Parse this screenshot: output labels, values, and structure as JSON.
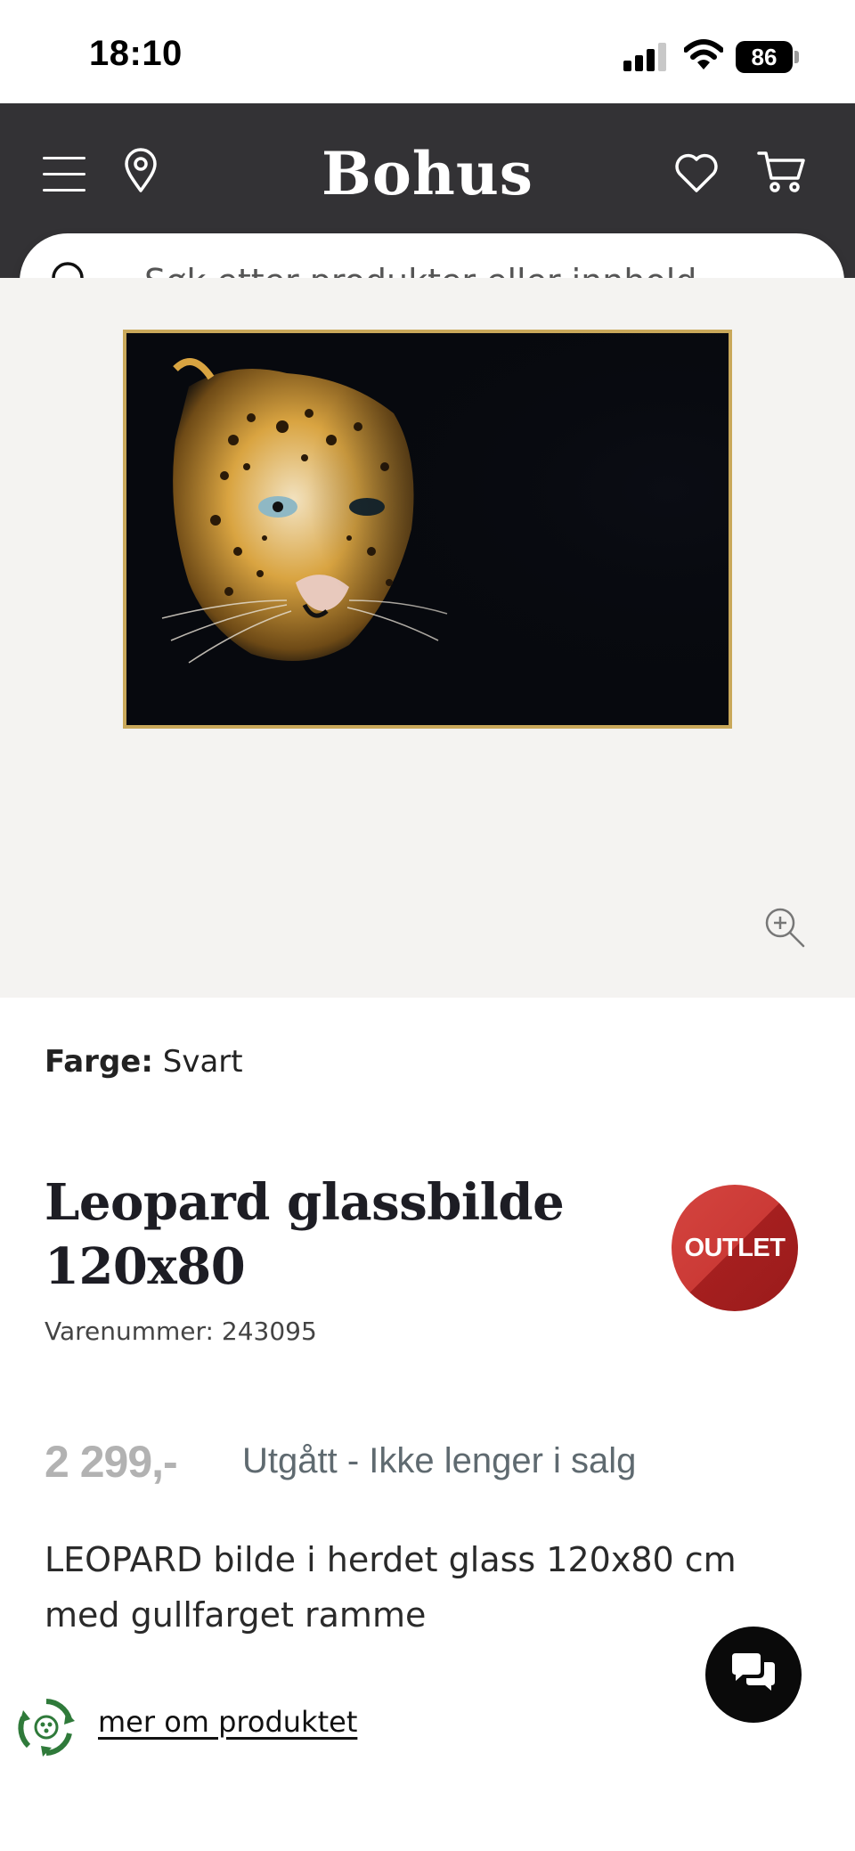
{
  "status_bar": {
    "time": "18:10",
    "battery": "86",
    "icons": [
      "signal-icon",
      "wifi-icon",
      "battery-icon"
    ]
  },
  "header": {
    "logo": "Bohus",
    "icons": [
      "menu-icon",
      "location-pin-icon",
      "heart-icon",
      "cart-icon"
    ],
    "background": "#333235"
  },
  "search": {
    "placeholder": "Søk etter produkter eller innhold ..."
  },
  "gallery": {
    "image_subject": "leopard-glass-picture",
    "zoom_icon": "zoom-in-icon"
  },
  "product": {
    "color_label": "Farge:",
    "color_value": "Svart",
    "title": "Leopard glassbilde 120x80",
    "badge": "OUTLET",
    "sku": "Varenummer: 243095",
    "price": "2 299,-",
    "status": "Utgått - Ikke lenger i salg",
    "description": "LEOPARD bilde i herdet glass 120x80 cm med gullfarget ramme",
    "more_link": "mer om produktet"
  },
  "colors": {
    "header_bg": "#333235",
    "badge_red": "#c8302c",
    "price_grey": "#b2b2b2",
    "gallery_bg": "#f4f3f1"
  },
  "chat": {
    "icon": "chat-bubbles-icon"
  }
}
